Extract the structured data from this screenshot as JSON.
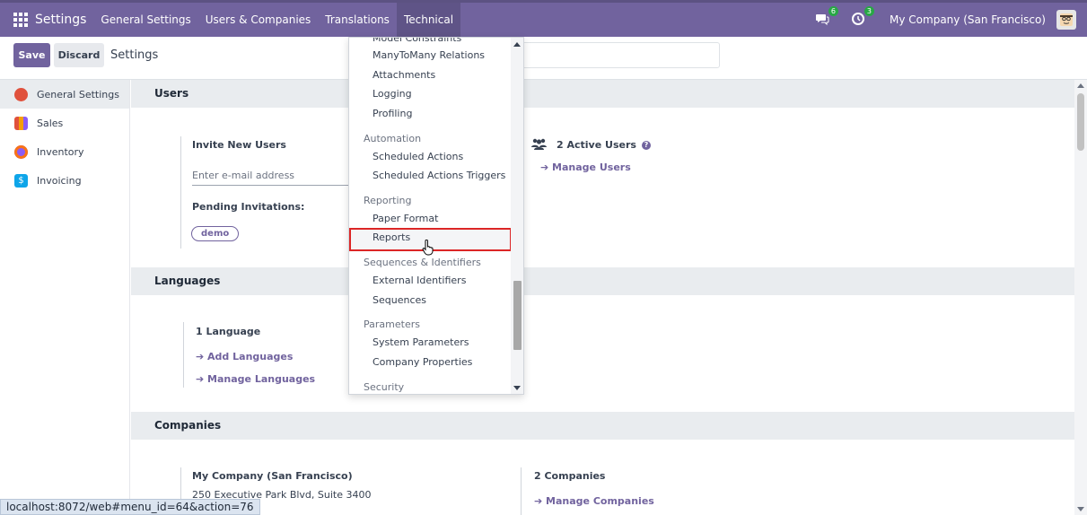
{
  "navbar": {
    "brand": "Settings",
    "menu": [
      "General Settings",
      "Users & Companies",
      "Translations",
      "Technical"
    ],
    "messages_badge": "6",
    "activity_badge": "3",
    "company": "My Company (San Francisco)"
  },
  "control_panel": {
    "save_label": "Save",
    "discard_label": "Discard",
    "title": "Settings"
  },
  "sidebar": {
    "items": [
      {
        "label": "General Settings",
        "color": "#e0513c"
      },
      {
        "label": "Sales",
        "color": "#f59e0b"
      },
      {
        "label": "Inventory",
        "color": "#8b5cf6"
      },
      {
        "label": "Invoicing",
        "color": "#0ea5e9"
      }
    ]
  },
  "users_section": {
    "header": "Users",
    "invite_label": "Invite New Users",
    "email_placeholder": "Enter e-mail address",
    "pending_label": "Pending Invitations:",
    "pending_user": "demo",
    "active_users": "2 Active Users",
    "manage_users": "Manage Users"
  },
  "languages_section": {
    "header": "Languages",
    "count": "1 Language",
    "add": "Add Languages",
    "manage": "Manage Languages"
  },
  "companies_section": {
    "header": "Companies",
    "company_name": "My Company (San Francisco)",
    "address": "250 Executive Park Blvd, Suite 3400",
    "count": "2 Companies",
    "manage": "Manage Companies"
  },
  "dropdown": {
    "top_clipped": "Model Constraints",
    "items_a": [
      "ManyToMany Relations",
      "Attachments",
      "Logging",
      "Profiling"
    ],
    "h_automation": "Automation",
    "items_automation": [
      "Scheduled Actions",
      "Scheduled Actions Triggers"
    ],
    "h_reporting": "Reporting",
    "items_reporting": [
      "Paper Format",
      "Reports"
    ],
    "h_sequences": "Sequences & Identifiers",
    "items_sequences": [
      "External Identifiers",
      "Sequences"
    ],
    "h_parameters": "Parameters",
    "items_parameters": [
      "System Parameters",
      "Company Properties"
    ],
    "h_security": "Security"
  },
  "statusbar": {
    "url": "localhost:8072/web#menu_id=64&action=76"
  }
}
